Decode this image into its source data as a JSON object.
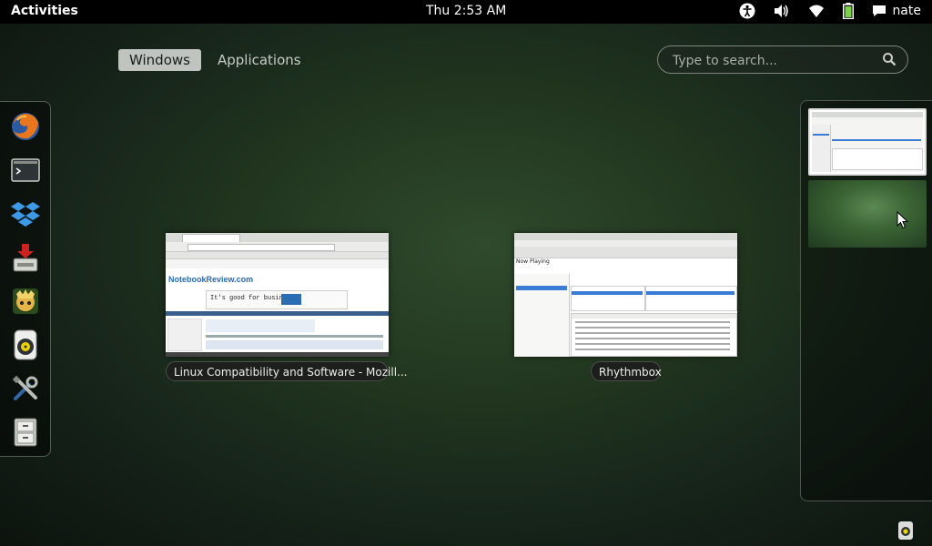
{
  "panel": {
    "activities": "Activities",
    "clock": "Thu  2:53 AM",
    "user": "nate",
    "tray_icons": [
      "accessibility-icon",
      "volume-icon",
      "wifi-icon",
      "battery-icon",
      "chat-icon"
    ]
  },
  "tabs": {
    "windows": "Windows",
    "applications": "Applications",
    "active": "Windows"
  },
  "search": {
    "placeholder": "Type to search..."
  },
  "dash": {
    "items": [
      {
        "name": "firefox-icon"
      },
      {
        "name": "terminal-icon"
      },
      {
        "name": "dropbox-icon"
      },
      {
        "name": "software-installer-icon"
      },
      {
        "name": "game-icon"
      },
      {
        "name": "rhythmbox-icon"
      },
      {
        "name": "settings-icon"
      },
      {
        "name": "file-cabinet-icon"
      }
    ]
  },
  "windows": [
    {
      "title": "Linux Compatibility and Software - Mozill..."
    },
    {
      "title": "Rhythmbox"
    }
  ],
  "firefox_thumb": {
    "site": "NotebookReview.com",
    "ad": "It's good for business."
  },
  "rhythmbox_thumb": {
    "header": "Now Playing"
  },
  "colors": {
    "accent_blue": "#3a7bd5",
    "panel": "#000000"
  }
}
